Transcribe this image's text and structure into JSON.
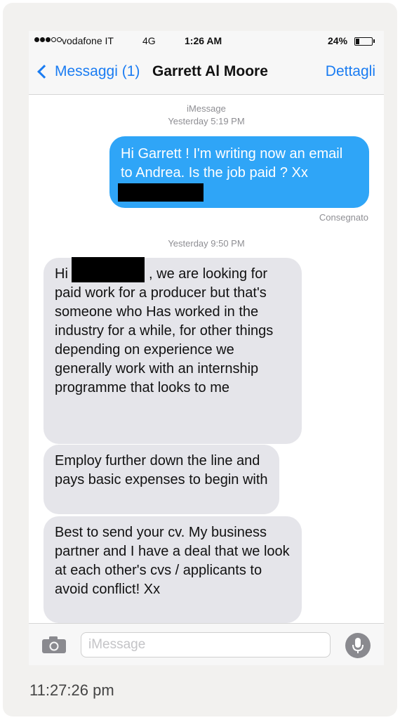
{
  "status_bar": {
    "carrier": "vodafone IT",
    "network": "4G",
    "time": "1:26 AM",
    "battery": "24%",
    "battery_level": 0.24
  },
  "nav": {
    "back_label": "Messaggi (1)",
    "contact_name": "Garrett Al Moore",
    "details_label": "Dettagli"
  },
  "thread": {
    "service_label": "iMessage",
    "first_time": "Yesterday 5:19 PM",
    "outgoing": {
      "text": "Hi Garrett ! I'm writing now an email to Andrea. Is the job paid ? Xx"
    },
    "delivered": "Consegnato",
    "second_time": "Yesterday 9:50 PM",
    "incoming": [
      {
        "prefix": "Hi",
        "text": ", we are looking for paid work for a producer but that's someone who Has worked in the industry for a while, for other things depending on experience we generally work with an internship programme that looks to me"
      },
      {
        "text": "Employ further down the line and pays basic expenses to begin with"
      },
      {
        "text": "Best to send your cv. My business partner and I have a deal that we look at each other's cvs / applicants to avoid conflict! Xx"
      }
    ]
  },
  "input_bar": {
    "placeholder": "iMessage",
    "camera_icon": "camera-icon",
    "mic_icon": "microphone-icon"
  },
  "screenshot_timestamp": "11:27:26 pm"
}
